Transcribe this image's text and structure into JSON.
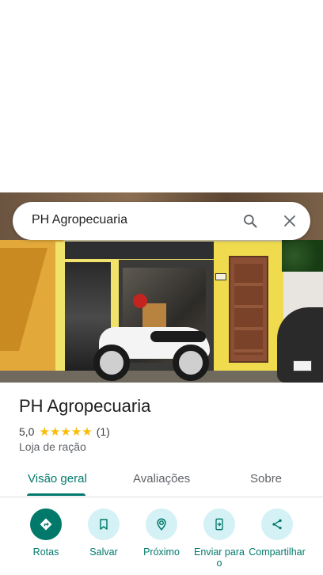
{
  "search": {
    "query": "PH Agropecuaria",
    "search_icon": "search-icon",
    "close_icon": "close-icon"
  },
  "place": {
    "name": "PH Agropecuaria",
    "rating": "5,0",
    "stars": "★★★★★",
    "review_count": "(1)",
    "category": "Loja de ração"
  },
  "tabs": [
    {
      "label": "Visão geral",
      "active": true
    },
    {
      "label": "Avaliações",
      "active": false
    },
    {
      "label": "Sobre",
      "active": false
    }
  ],
  "actions": [
    {
      "label": "Rotas",
      "icon": "directions-icon"
    },
    {
      "label": "Salvar",
      "icon": "bookmark-icon"
    },
    {
      "label": "Próximo",
      "icon": "nearby-icon"
    },
    {
      "label": "Enviar para o",
      "icon": "send-to-phone-icon"
    },
    {
      "label": "Compartilhar",
      "icon": "share-icon"
    }
  ],
  "colors": {
    "accent": "#00796b",
    "action_bg": "#d4f1f5",
    "star": "#fbbc04"
  }
}
